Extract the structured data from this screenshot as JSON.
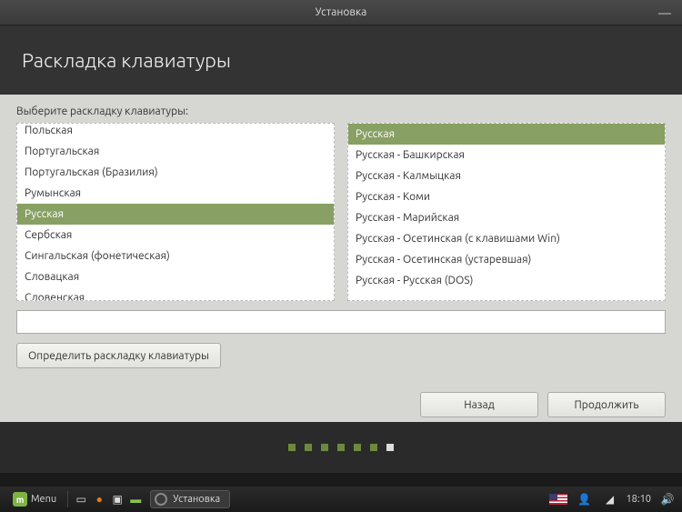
{
  "window": {
    "title": "Установка",
    "minimize": "—"
  },
  "header": {
    "title": "Раскладка клавиатуры"
  },
  "prompt": "Выберите раскладку клавиатуры:",
  "layouts": {
    "items": [
      "Польская",
      "Португальская",
      "Португальская (Бразилия)",
      "Румынская",
      "Русская",
      "Сербская",
      "Сингальская (фонетическая)",
      "Словацкая",
      "Словенская"
    ],
    "selectedIndex": 4
  },
  "variants": {
    "items": [
      "Русская",
      "Русская - Башкирская",
      "Русская - Калмыцкая",
      "Русская - Коми",
      "Русская - Марийская",
      "Русская - Осетинская (с клавишами Win)",
      "Русская - Осетинская (устаревшая)",
      "Русская - Русская (DOS)"
    ],
    "selectedIndex": 0
  },
  "test_input": {
    "value": "",
    "placeholder": ""
  },
  "buttons": {
    "detect": "Определить раскладку клавиатуры",
    "back": "Назад",
    "continue": "Продолжить"
  },
  "progress": {
    "total": 7,
    "current": 6
  },
  "taskbar": {
    "menu": "Menu",
    "app": "Установка",
    "clock": "18:10"
  }
}
